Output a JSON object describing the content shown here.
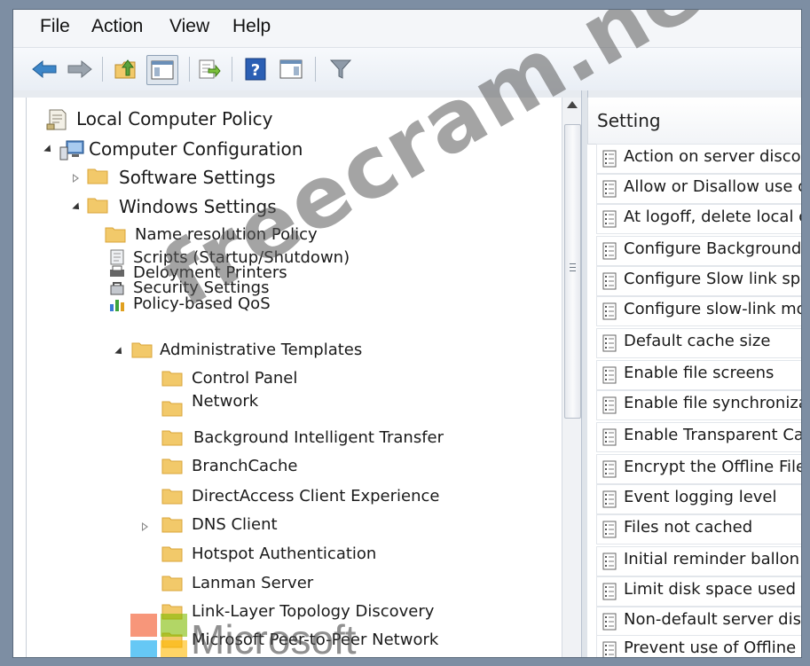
{
  "menu": [
    "File",
    "Action",
    "View",
    "Help"
  ],
  "toolbar": {
    "buttons": [
      {
        "name": "back-arrow-icon"
      },
      {
        "name": "forward-arrow-icon"
      },
      {
        "name": "up-folder-icon"
      },
      {
        "name": "show-hide-console-tree-icon"
      },
      {
        "name": "export-list-icon"
      },
      {
        "name": "help-icon"
      },
      {
        "name": "show-hide-action-pane-icon"
      },
      {
        "name": "filter-icon"
      }
    ]
  },
  "tree": {
    "root": "Local Computer Policy",
    "computer_config": "Computer Configuration",
    "software_settings": "Software Settings",
    "windows_settings": "Windows Settings",
    "name_resolution": "Name resolution Policy",
    "scripts": "Scripts (Startup/Shutdown)",
    "deployed_printers": "Deloyment Printers",
    "security_settings": "Security Settings",
    "qos": "Policy-based QoS",
    "admin_templates": "Administrative Templates",
    "admin_children": [
      "Control Panel",
      "Network",
      "Background Intelligent Transfer",
      "BranchCache",
      "DirectAccess Client Experience",
      "DNS Client",
      "Hotspot Authentication",
      "Lanman Server",
      "Link-Layer Topology Discovery",
      "Microsoft Peer-to-Peer Network"
    ]
  },
  "settings": {
    "header": "Setting",
    "rows": [
      "Action on server disconn",
      "Allow or Disallow use of",
      "At logoff, delete local co",
      "Configure Background S",
      "Configure Slow link spee",
      "Configure slow-link mod",
      "Default cache size",
      "Enable file screens",
      "Enable file synchronizat",
      "Enable Transparent Cac",
      "Encrypt the Offline Files",
      "Event logging level",
      "Files not cached",
      "Initial reminder ballon li",
      "Limit disk space used b",
      "Non-default server disc",
      "Prevent use of Offline F"
    ]
  },
  "watermark": "freecram.net",
  "brand": "Microsoft",
  "colors": {
    "folder": "#f2c96a",
    "folder_dark": "#d9a53a",
    "ms_red": "#f25022",
    "ms_green": "#7fba00",
    "ms_blue": "#00a4ef",
    "ms_yellow": "#ffb900"
  }
}
